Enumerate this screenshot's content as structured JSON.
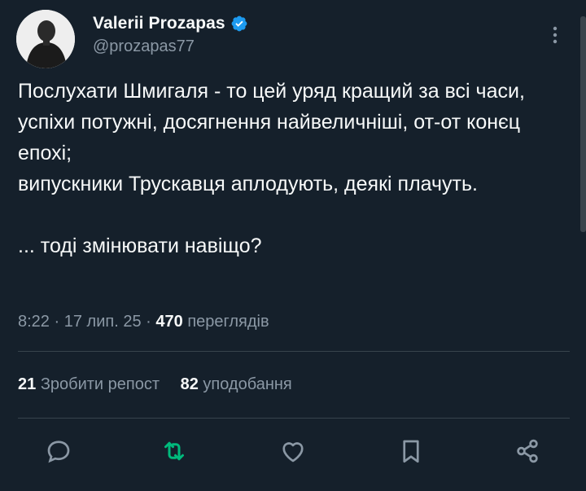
{
  "author": {
    "display_name": "Valerii Prozapas",
    "handle": "@prozapas77",
    "verified": true
  },
  "tweet": {
    "lines": [
      "Послухати Шмигаля - то цей уряд кращий за всі часи, успіхи потужні, досягнення найвеличніші, от-от конєц епохі;",
      "випускники Трускавця аплодують, деякі плачуть.",
      "... тоді змінювати навіщо?"
    ]
  },
  "meta": {
    "time": "8:22",
    "separator": "·",
    "date": "17 лип. 25",
    "views_count": "470",
    "views_label": "переглядів"
  },
  "stats": {
    "reposts_count": "21",
    "reposts_label": "Зробити репост",
    "likes_count": "82",
    "likes_label": "уподобання"
  },
  "icons": {
    "more": "more-vertical-icon",
    "reply": "reply-icon",
    "repost": "repost-icon",
    "like": "heart-icon",
    "bookmark": "bookmark-icon",
    "share": "share-icon"
  },
  "colors": {
    "background": "#15202b",
    "text": "#f7f9f9",
    "secondary": "#8b98a5",
    "verified": "#1d9bf0",
    "repost_active": "#00ba7c",
    "divider": "#38444d"
  }
}
